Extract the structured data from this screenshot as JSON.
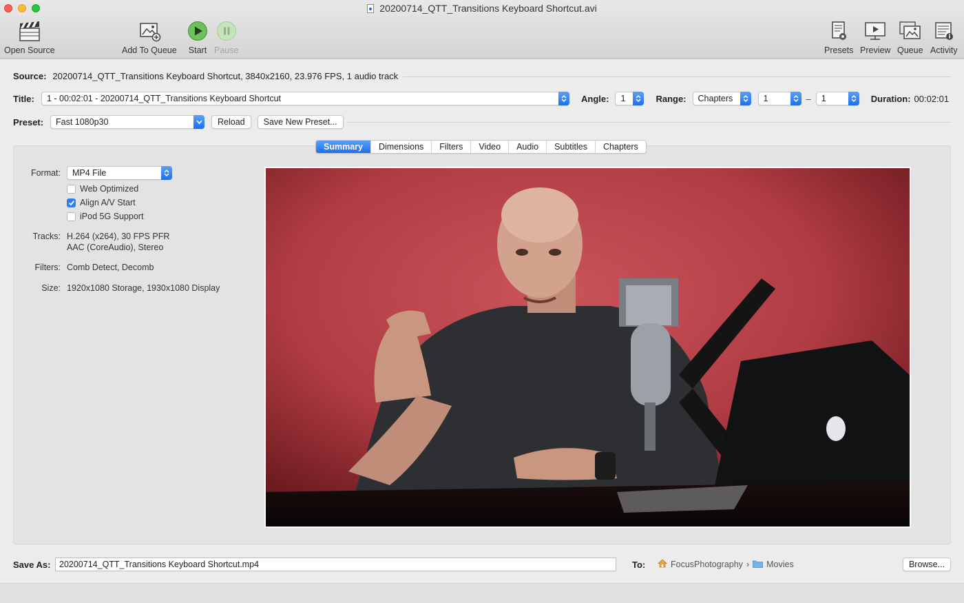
{
  "window": {
    "title": "20200714_QTT_Transitions Keyboard Shortcut.avi"
  },
  "toolbar": {
    "open_source": "Open Source",
    "add_to_queue": "Add To Queue",
    "start": "Start",
    "pause": "Pause",
    "presets": "Presets",
    "preview": "Preview",
    "queue": "Queue",
    "activity": "Activity"
  },
  "source": {
    "label": "Source:",
    "value": "20200714_QTT_Transitions Keyboard Shortcut, 3840x2160, 23.976 FPS, 1 audio track"
  },
  "title_row": {
    "label": "Title:",
    "value": "1 - 00:02:01 - 20200714_QTT_Transitions Keyboard Shortcut",
    "angle_label": "Angle:",
    "angle_value": "1",
    "range_label": "Range:",
    "range_type": "Chapters",
    "range_start": "1",
    "range_dash": "–",
    "range_end": "1",
    "duration_label": "Duration:",
    "duration_value": "00:02:01"
  },
  "preset": {
    "label": "Preset:",
    "value": "Fast 1080p30",
    "reload": "Reload",
    "save_new": "Save New Preset..."
  },
  "tabs": [
    {
      "label": "Summary",
      "active": true
    },
    {
      "label": "Dimensions",
      "active": false
    },
    {
      "label": "Filters",
      "active": false
    },
    {
      "label": "Video",
      "active": false
    },
    {
      "label": "Audio",
      "active": false
    },
    {
      "label": "Subtitles",
      "active": false
    },
    {
      "label": "Chapters",
      "active": false
    }
  ],
  "summary": {
    "format_label": "Format:",
    "format_value": "MP4 File",
    "web_optimized": {
      "label": "Web Optimized",
      "checked": false
    },
    "align_av": {
      "label": "Align A/V Start",
      "checked": true
    },
    "ipod": {
      "label": "iPod 5G Support",
      "checked": false
    },
    "tracks_label": "Tracks:",
    "tracks_line1": "H.264 (x264), 30 FPS PFR",
    "tracks_line2": "AAC (CoreAudio), Stereo",
    "filters_label": "Filters:",
    "filters_value": "Comb Detect, Decomb",
    "size_label": "Size:",
    "size_value": "1920x1080 Storage, 1930x1080 Display"
  },
  "save": {
    "label": "Save As:",
    "value": "20200714_QTT_Transitions Keyboard Shortcut.mp4",
    "to_label": "To:",
    "path_home": "FocusPhotography",
    "path_sep": "›",
    "path_folder": "Movies",
    "browse": "Browse..."
  },
  "colors": {
    "accent": "#2f7cf6",
    "preview_bg": "#c1474d"
  }
}
